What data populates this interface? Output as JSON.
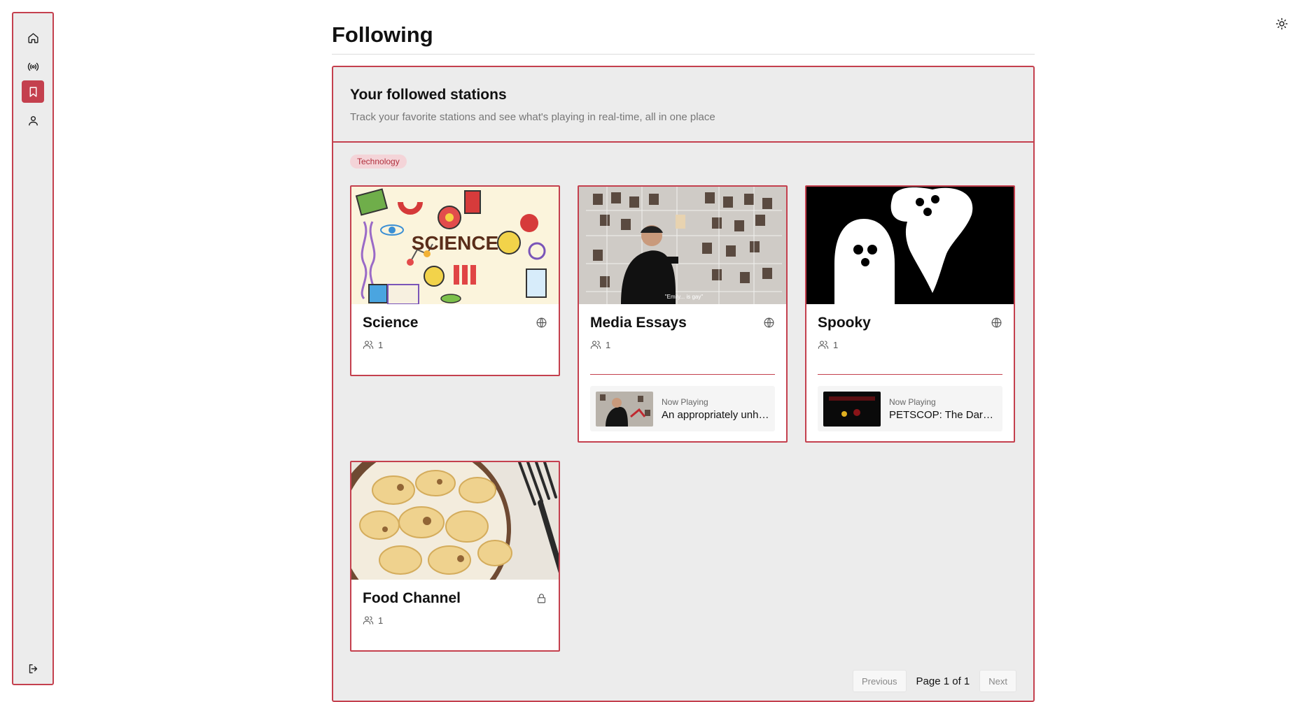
{
  "sidebar": {
    "items": [
      {
        "name": "home",
        "icon": "home-icon"
      },
      {
        "name": "stations",
        "icon": "broadcast-icon"
      },
      {
        "name": "following",
        "icon": "bookmark-icon",
        "active": true
      },
      {
        "name": "profile",
        "icon": "user-icon"
      }
    ],
    "logout_icon": "logout-icon"
  },
  "theme_toggle_icon": "sun-icon",
  "page": {
    "title": "Following"
  },
  "panel": {
    "heading": "Your followed stations",
    "subheading": "Track your favorite stations and see what's playing in real-time, all in one place",
    "tag": "Technology"
  },
  "stations": [
    {
      "name": "Science",
      "visibility_icon": "globe-icon",
      "listeners": "1"
    },
    {
      "name": "Media Essays",
      "visibility_icon": "globe-icon",
      "listeners": "1",
      "now_playing_label": "Now Playing",
      "now_playing_title": "An appropriately unhinged video essay"
    },
    {
      "name": "Spooky",
      "visibility_icon": "globe-icon",
      "listeners": "1",
      "now_playing_label": "Now Playing",
      "now_playing_title": "PETSCOP: The Dark Secret"
    },
    {
      "name": "Food Channel",
      "visibility_icon": "lock-icon",
      "listeners": "1"
    }
  ],
  "pagination": {
    "previous": "Previous",
    "status": "Page 1 of 1",
    "next": "Next"
  },
  "colors": {
    "accent": "#c4404e",
    "panel_bg": "#ececec",
    "tag_bg": "#f4d4d8"
  }
}
